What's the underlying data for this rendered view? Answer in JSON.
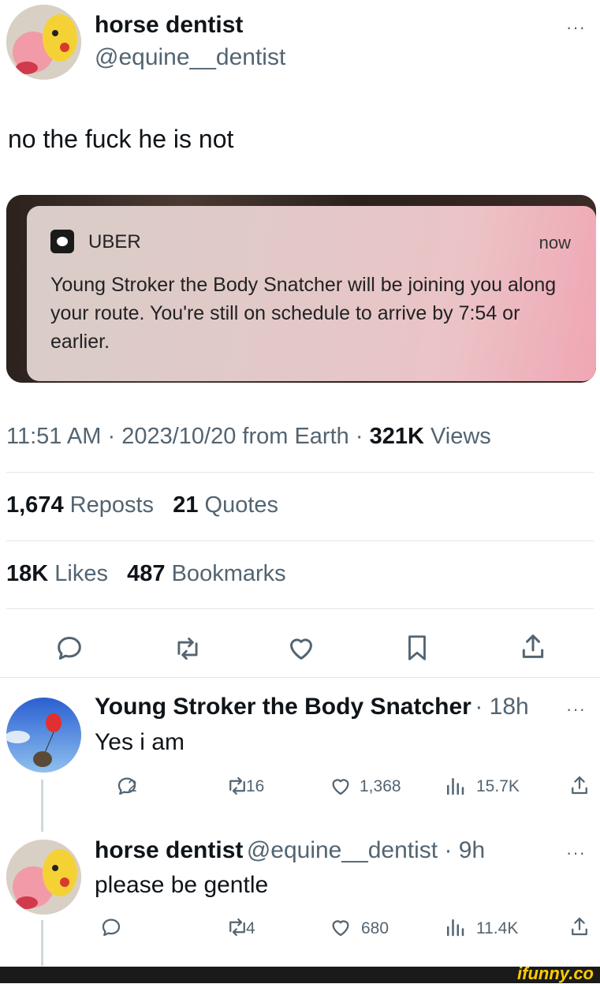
{
  "tweet": {
    "author_name": "horse dentist",
    "author_handle": "@equine__dentist",
    "more": "···",
    "text": "no the fuck he is not",
    "image": {
      "app_name": "UBER",
      "time": "now",
      "message": "Young Stroker the Body Snatcher will be joining you along your route. You're still on schedule to arrive by 7:54 or earlier."
    },
    "meta": {
      "time": "11:51 AM",
      "date": "2023/10/20",
      "source": "from Earth",
      "views_count": "321K",
      "views_label": "Views",
      "sep": "·"
    },
    "stats": {
      "reposts_count": "1,674",
      "reposts_label": "Reposts",
      "quotes_count": "21",
      "quotes_label": "Quotes",
      "likes_count": "18K",
      "likes_label": "Likes",
      "bookmarks_count": "487",
      "bookmarks_label": "Bookmarks"
    }
  },
  "replies": [
    {
      "name": "Young Stroker the Body Snatcher",
      "meta": "· 18h",
      "text": "Yes i am",
      "replies": "2",
      "reposts": "16",
      "likes": "1,368",
      "views": "15.7K"
    },
    {
      "name": "horse dentist",
      "meta": "@equine__dentist · 9h",
      "text": "please be gentle",
      "replies": "",
      "reposts": "4",
      "likes": "680",
      "views": "11.4K"
    }
  ],
  "watermark": "ifunny.co",
  "colors": {
    "text": "#0f1419",
    "muted": "#536471",
    "divider": "#e1e6ea",
    "watermark": "#ffcc00"
  },
  "icons": [
    "reply-icon",
    "repost-icon",
    "like-icon",
    "bookmark-icon",
    "share-icon",
    "views-icon",
    "more-icon"
  ]
}
